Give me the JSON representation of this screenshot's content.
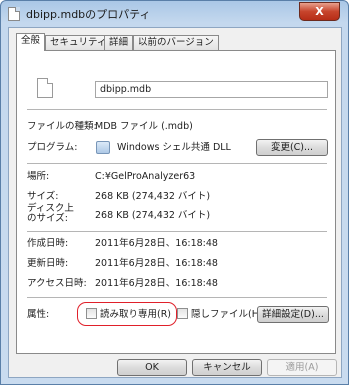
{
  "window": {
    "title": "dbipp.mdbのプロパティ",
    "close_glyph": "X"
  },
  "tabs": [
    {
      "label": "全般"
    },
    {
      "label": "セキュリティ"
    },
    {
      "label": "詳細"
    },
    {
      "label": "以前のバージョン"
    }
  ],
  "general": {
    "file_name": "dbipp.mdb",
    "file_type": {
      "label": "ファイルの種類:",
      "value": "MDB ファイル (.mdb)"
    },
    "program": {
      "label": "プログラム:",
      "value": "Windows シェル共通 DLL",
      "change_button": "変更(C)..."
    },
    "location": {
      "label": "場所:",
      "value": "C:¥GelProAnalyzer63"
    },
    "size": {
      "label": "サイズ:",
      "value": "268 KB (274,432 バイト)"
    },
    "size_on_disk": {
      "label_line1": "ディスク上",
      "label_line2": "のサイズ:",
      "value": "268 KB (274,432 バイト)"
    },
    "created": {
      "label": "作成日時:",
      "value": "2011年6月28日、16:18:48"
    },
    "modified": {
      "label": "更新日時:",
      "value": "2011年6月28日、16:18:48"
    },
    "accessed": {
      "label": "アクセス日時:",
      "value": "2011年6月28日、16:18:48"
    },
    "attributes": {
      "label": "属性:",
      "readonly": {
        "label": "読み取り専用(R)",
        "checked": false
      },
      "hidden": {
        "label": "隠しファイル(H)",
        "checked": false
      },
      "advanced_button": "詳細設定(D)..."
    }
  },
  "footer": {
    "ok": "OK",
    "cancel": "キャンセル",
    "apply": "適用(A)"
  },
  "colors": {
    "highlight": "#e0202a",
    "close": "#c7442c"
  }
}
